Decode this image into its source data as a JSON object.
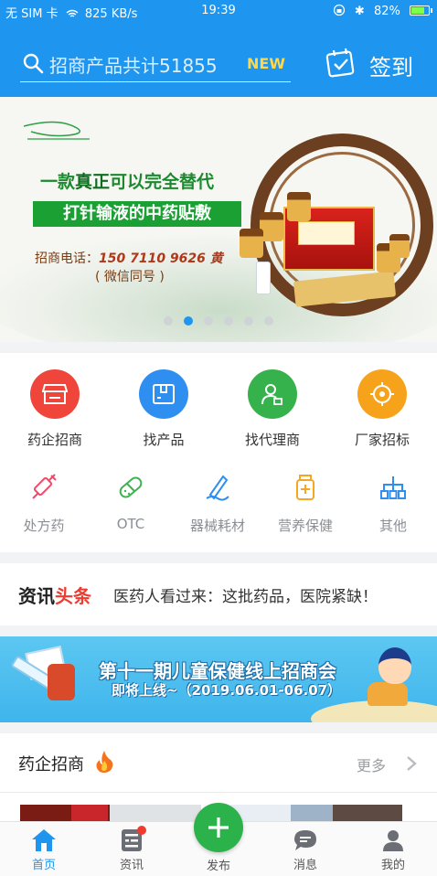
{
  "status_bar": {
    "carrier": "无 SIM 卡",
    "speed": "825 KB/s",
    "time": "19:39",
    "battery": "82%"
  },
  "header": {
    "search_placeholder": "招商产品共计51855",
    "search_badge": "NEW",
    "checkin_label": "签到",
    "bg_color": "#1e95ee"
  },
  "banner": {
    "headline": [
      "一款",
      "真正",
      "可以完全替代"
    ],
    "tagline": "打针输液的中药贴敷",
    "contact_label": "招商电话：",
    "contact_number": "150 7110 9626 黄",
    "wechat_note": "( 微信同号 )",
    "carousel_total": 6,
    "carousel_active": 1
  },
  "categories_primary": [
    {
      "label": "药企招商",
      "icon": "store-icon",
      "color": "#f0453a"
    },
    {
      "label": "找产品",
      "icon": "box-icon",
      "color": "#2f8ff0"
    },
    {
      "label": "找代理商",
      "icon": "agent-icon",
      "color": "#36b24c"
    },
    {
      "label": "厂家招标",
      "icon": "target-icon",
      "color": "#f7a21b"
    }
  ],
  "categories_secondary": [
    {
      "label": "处方药",
      "icon": "syringe-icon",
      "color": "#ef4b6a"
    },
    {
      "label": "OTC",
      "icon": "capsule-icon",
      "color": "#3db44f"
    },
    {
      "label": "器械耗材",
      "icon": "instrument-icon",
      "color": "#2f8ff0"
    },
    {
      "label": "营养保健",
      "icon": "supplement-bottle-icon",
      "color": "#f5a623"
    },
    {
      "label": "其他",
      "icon": "network-icon",
      "color": "#2f8ff0"
    }
  ],
  "news": {
    "brand_main": "资讯",
    "brand_accent": "头条",
    "headline": "医药人看过来：这批药品，医院紧缺！"
  },
  "promo": {
    "title": "第十一期儿童保健线上招商会",
    "subtitle": "即将上线~（2019.06.01-06.07）"
  },
  "section": {
    "title": "药企招商",
    "more": "更多"
  },
  "tabbar": {
    "home": "首页",
    "news": "资讯",
    "publish": "发布",
    "messages": "消息",
    "profile": "我的"
  }
}
